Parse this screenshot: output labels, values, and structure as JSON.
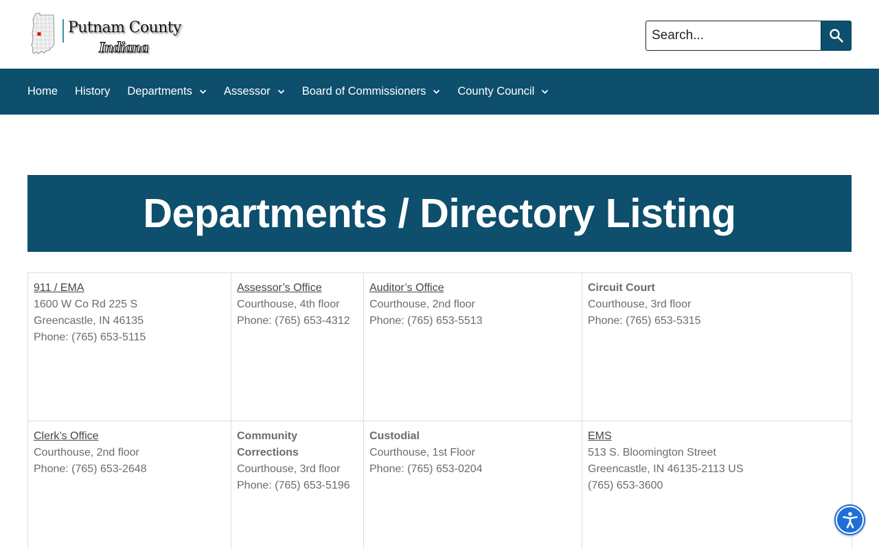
{
  "logo": {
    "line1": "Putnam County",
    "line2": "Indiana",
    "highlight_color": "#e01010"
  },
  "search": {
    "placeholder": "Search...",
    "icon": "search-icon"
  },
  "nav": {
    "items": [
      {
        "label": "Home",
        "dropdown": false
      },
      {
        "label": "History",
        "dropdown": false
      },
      {
        "label": "Departments",
        "dropdown": true
      },
      {
        "label": "Assessor",
        "dropdown": true
      },
      {
        "label": "Board of Commissioners",
        "dropdown": true
      },
      {
        "label": "County Council",
        "dropdown": true
      }
    ]
  },
  "page": {
    "title": "Departments / Directory Listing"
  },
  "directory": {
    "rows": [
      [
        {
          "name": "911 / EMA",
          "link": true,
          "lines": [
            "1600 W Co Rd 225 S",
            "Greencastle, IN 46135",
            "Phone: (765) 653-5115"
          ]
        },
        {
          "name": "Assessor’s Office",
          "link": true,
          "lines": [
            "Courthouse, 4th floor",
            "Phone: (765) 653-4312"
          ]
        },
        {
          "name": "Auditor’s Office",
          "link": true,
          "lines": [
            "Courthouse, 2nd floor",
            "Phone: (765) 653-5513"
          ]
        },
        {
          "name": "Circuit Court",
          "link": false,
          "lines": [
            "Courthouse, 3rd floor",
            "Phone: (765) 653-5315"
          ]
        }
      ],
      [
        {
          "name": "Clerk’s Office",
          "link": true,
          "lines": [
            "Courthouse, 2nd floor",
            "Phone: (765) 653-2648"
          ]
        },
        {
          "name": "Community Corrections",
          "link": false,
          "lines": [
            "Courthouse, 3rd floor",
            "Phone: (765) 653-5196"
          ]
        },
        {
          "name": "Custodial",
          "link": false,
          "lines": [
            "Courthouse, 1st Floor",
            "Phone: (765) 653-0204"
          ]
        },
        {
          "name": "EMS",
          "link": true,
          "lines": [
            "513 S. Bloomington Street",
            "Greencastle, IN 46135-2113 US",
            "(765) 653-3600"
          ]
        }
      ]
    ]
  },
  "accessibility": {
    "icon": "accessibility-icon",
    "color": "#1f6fd6"
  },
  "colors": {
    "brand": "#0d4f6c",
    "text": "#6b6b6b"
  }
}
